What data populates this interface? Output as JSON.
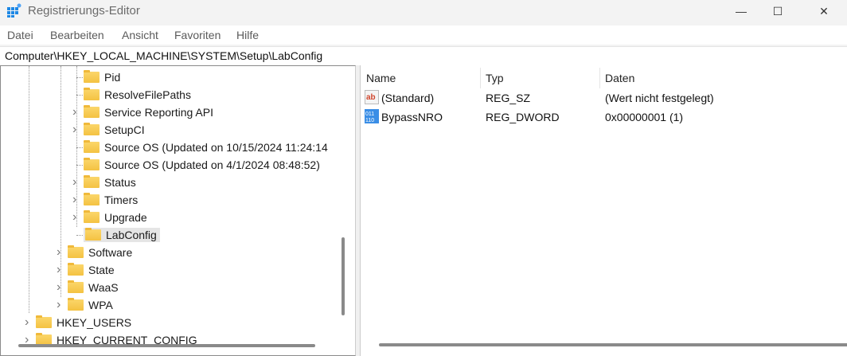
{
  "window": {
    "title": "Registrierungs-Editor",
    "minimize": "—",
    "maximize": "☐",
    "close": "✕"
  },
  "menu": [
    "Datei",
    "Bearbeiten",
    "Ansicht",
    "Favoriten",
    "Hilfe"
  ],
  "address": "Computer\\HKEY_LOCAL_MACHINE\\SYSTEM\\Setup\\LabConfig",
  "tree": [
    {
      "label": "Pid",
      "chevron": false
    },
    {
      "label": "ResolveFilePaths",
      "chevron": false
    },
    {
      "label": "Service Reporting API",
      "chevron": true
    },
    {
      "label": "SetupCI",
      "chevron": true
    },
    {
      "label": "Source OS (Updated on 10/15/2024 11:24:14",
      "chevron": false
    },
    {
      "label": "Source OS (Updated on 4/1/2024 08:48:52)",
      "chevron": false
    },
    {
      "label": "Status",
      "chevron": true
    },
    {
      "label": "Timers",
      "chevron": true
    },
    {
      "label": "Upgrade",
      "chevron": true
    },
    {
      "label": "LabConfig",
      "chevron": false,
      "selected": true
    },
    {
      "label": "Software",
      "chevron": true
    },
    {
      "label": "State",
      "chevron": true
    },
    {
      "label": "WaaS",
      "chevron": true
    },
    {
      "label": "WPA",
      "chevron": true
    },
    {
      "label": "HKEY_USERS",
      "chevron": true
    },
    {
      "label": "HKEY_CURRENT_CONFIG",
      "chevron": true
    }
  ],
  "list": {
    "columns": [
      "Name",
      "Typ",
      "Daten"
    ],
    "rows": [
      {
        "icon": "string-value-icon",
        "name": "(Standard)",
        "type": "REG_SZ",
        "data": "(Wert nicht festgelegt)"
      },
      {
        "icon": "binary-value-icon",
        "name": "BypassNRO",
        "type": "REG_DWORD",
        "data": "0x00000001 (1)"
      }
    ]
  }
}
